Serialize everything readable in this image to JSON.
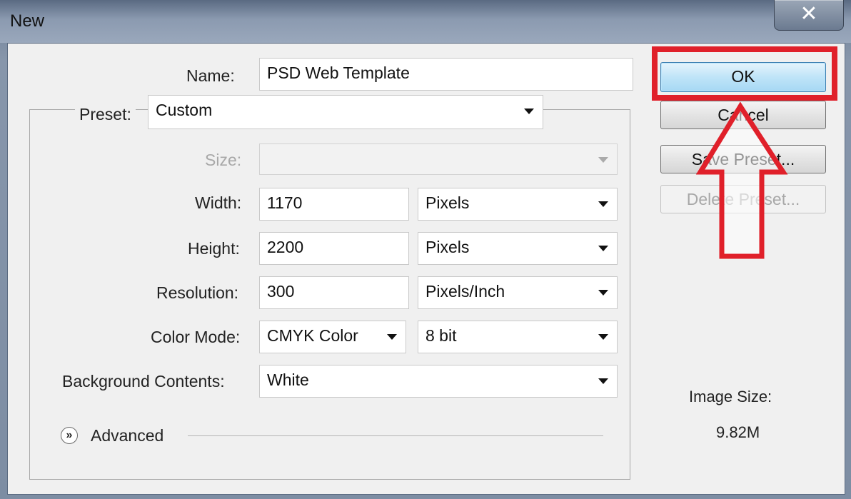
{
  "window": {
    "title": "New",
    "close_glyph": "✕"
  },
  "form": {
    "name": {
      "label": "Name:",
      "value": "PSD Web Template"
    },
    "preset": {
      "label": "Preset:",
      "value": "Custom"
    },
    "size": {
      "label": "Size:",
      "value": ""
    },
    "width": {
      "label": "Width:",
      "value": "1170",
      "unit": "Pixels"
    },
    "height": {
      "label": "Height:",
      "value": "2200",
      "unit": "Pixels"
    },
    "resolution": {
      "label": "Resolution:",
      "value": "300",
      "unit": "Pixels/Inch"
    },
    "color_mode": {
      "label": "Color Mode:",
      "value": "CMYK Color",
      "depth": "8 bit"
    },
    "background": {
      "label": "Background Contents:",
      "value": "White"
    },
    "advanced": {
      "label": "Advanced",
      "icon": "double-chevron-down-icon"
    }
  },
  "buttons": {
    "ok": "OK",
    "cancel": "Cancel",
    "save_preset": "Save Preset...",
    "delete_preset": "Delete Preset..."
  },
  "image_size": {
    "label": "Image Size:",
    "value": "9.82M"
  },
  "annotation": {
    "highlight_color": "#e0202a"
  }
}
